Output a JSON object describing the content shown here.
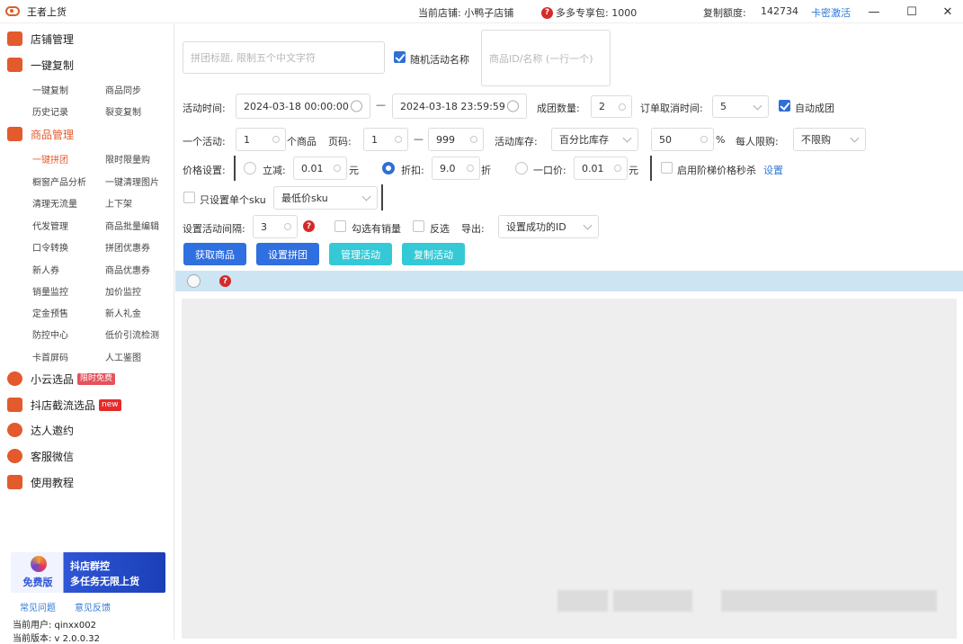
{
  "titlebar": {
    "app_title": "王者上货",
    "store_label": "当前店铺: 小鸭子店铺",
    "pack_label": "多多专享包: 1000",
    "quota_label": "复制额度:",
    "quota_value": "142734",
    "activate_link": "卡密激活",
    "minimize": "—",
    "maximize": "☐",
    "close": "✕"
  },
  "sidebar": {
    "shop_mgmt": "店铺管理",
    "one_click_copy": "一键复制",
    "copy_subs": [
      "一键复制",
      "商品同步",
      "历史记录",
      "裂变复制"
    ],
    "product_mgmt": "商品管理",
    "product_subs": [
      "一键拼团",
      "限时限量购",
      "橱窗产品分析",
      "一键清理图片",
      "清理无流量",
      "上下架",
      "代发管理",
      "商品批量编辑",
      "口令转换",
      "拼团优惠券",
      "新人券",
      "商品优惠券",
      "销量监控",
      "加价监控",
      "定金预售",
      "新人礼金",
      "防控中心",
      "低价引流检测",
      "卡首屏码",
      "人工鉴图"
    ],
    "xiaoyun": "小云选品",
    "xiaoyun_badge": "限时免费",
    "doudian": "抖店截流选品",
    "doudian_badge": "new",
    "influencer": "达人邀约",
    "support": "客服微信",
    "tutorial": "使用教程",
    "banner_free": "免费版",
    "banner_line1": "抖店群控",
    "banner_line2": "多任务无限上货",
    "faq": "常见问题",
    "feedback": "意见反馈",
    "user_label": "当前用户: qinxx002",
    "version_label": "当前版本: v 2.0.0.32"
  },
  "form": {
    "title_placeholder": "拼团标题, 限制五个中文字符",
    "random_name_label": "随机活动名称",
    "random_name_checked": true,
    "product_id_placeholder": "商品ID/名称 (一行一个)",
    "time_label": "活动时间:",
    "start_time": "2024-03-18 00:00:00",
    "time_sep": "—",
    "end_time": "2024-03-18 23:59:59",
    "group_count_label": "成团数量:",
    "group_count": "2",
    "order_cancel_label": "订单取消时间:",
    "order_cancel": "5",
    "auto_group_label": "自动成团",
    "auto_group_checked": true,
    "per_activity_label": "一个活动:",
    "per_activity": "1",
    "per_unit": "个商品",
    "page_label": "页码:",
    "page_from": "1",
    "page_sep": "—",
    "page_to": "999",
    "stock_label": "活动库存:",
    "stock_mode": "百分比库存",
    "stock_value": "50",
    "stock_unit": "%",
    "limit_label": "每人限购:",
    "limit_value": "不限购",
    "price_label": "价格设置:",
    "price_off_label": "立减:",
    "price_off_value": "0.01",
    "price_off_unit": "元",
    "discount_label": "折扣:",
    "discount_value": "9.0",
    "discount_unit": "折",
    "fixed_label": "一口价:",
    "fixed_value": "0.01",
    "fixed_unit": "元",
    "ladder_label": "启用阶梯价格秒杀",
    "ladder_setting": "设置",
    "single_sku_label": "只设置单个sku",
    "sku_mode": "最低价sku",
    "interval_label": "设置活动间隔:",
    "interval_value": "3",
    "sales_label": "勾选有销量",
    "invert_label": "反选",
    "export_label": "导出:",
    "export_value": "设置成功的ID"
  },
  "actions": {
    "get_products": "获取商品",
    "set_group": "设置拼团",
    "manage": "管理活动",
    "copy": "复制活动"
  },
  "colors": {
    "accent": "#e35a2c",
    "primary": "#2f6fe0",
    "teal": "#35c9d7",
    "link": "#2f7ad8"
  }
}
